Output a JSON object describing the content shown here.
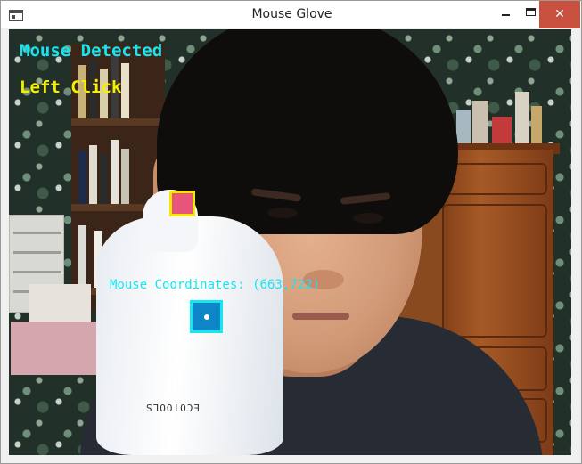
{
  "window": {
    "title": "Mouse Glove",
    "close_glyph": "✕"
  },
  "icons": {
    "app": "app-window-icon",
    "minimize": "minimize-icon",
    "maximize": "maximize-icon",
    "close": "close-icon"
  },
  "overlay": {
    "status": "Mouse Detected",
    "action": "Left Click",
    "coordinates": "Mouse Coordinates: (663,722)"
  },
  "colors": {
    "status_text": "#16e6f0",
    "action_text": "#f5f000",
    "click_marker_fill": "#e8557a",
    "click_marker_border": "#f5e800",
    "pointer_marker_fill": "#0d86c8",
    "pointer_marker_border": "#16e6f0",
    "close_button": "#c7503f"
  },
  "scene": {
    "glove_brand_text": "ECOTOOLS"
  }
}
